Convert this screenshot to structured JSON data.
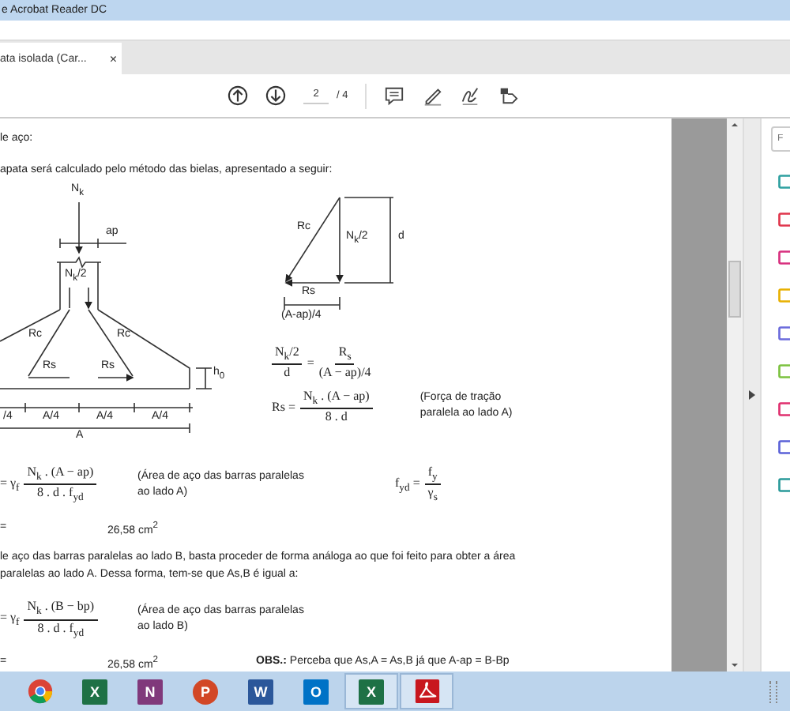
{
  "window": {
    "title": "e Acrobat Reader DC"
  },
  "tabs": [
    {
      "label": "ata isolada (Car...",
      "selected": true,
      "close": "×"
    }
  ],
  "toolbar": {
    "page_value": "2",
    "page_total": "/ 4"
  },
  "document": {
    "heading": "le aço:",
    "intro": "apata será calculado pelo método das bielas, apresentado a seguir:",
    "footing_diagram": {
      "load": "N$_{k}$",
      "column_width": "ap",
      "half_load": "N$_{k}$/2",
      "struts": [
        "Rc",
        "Rc"
      ],
      "ties": [
        "Rs",
        "Rs"
      ],
      "height": "h$_{0}$",
      "segments": [
        "/4",
        "A/4",
        "A/4",
        "A/4"
      ],
      "width": "A"
    },
    "force_triangle": {
      "strut": "Rc",
      "load": "N$_{k}$/2",
      "depth": "d",
      "tie": "Rs",
      "base": "(A-ap)/4"
    },
    "equations": [
      {
        "parts": [
          {
            "kind": "frac",
            "num": "N$_{k}$/2",
            "den": "d"
          },
          {
            "kind": "text",
            "text": "="
          },
          {
            "kind": "frac",
            "num": "R$_{s}$",
            "den": "(A − ap)/4"
          }
        ]
      },
      {
        "parts": [
          {
            "kind": "text",
            "text": "Rs ="
          },
          {
            "kind": "frac",
            "num": "N$_{k}$ . (A − ap)",
            "den": "8 . d"
          }
        ],
        "note": [
          "(Força de tração",
          "paralela ao lado A)"
        ]
      }
    ],
    "rows": [
      {
        "kind": "formula_row",
        "formula": [
          {
            "kind": "text",
            "text": "= γ$_{f}$"
          },
          {
            "kind": "frac",
            "num": "N$_{k}$ . (A − ap)",
            "den": "8 . d . f$_{yd}$"
          }
        ],
        "note": [
          "(Área de aço das barras paralelas",
          "ao lado A)"
        ],
        "side_formula": [
          {
            "kind": "text",
            "text": "f$_{yd}$ ="
          },
          {
            "kind": "frac",
            "num": "f$_{y}$",
            "den": "γ$_{s}$"
          }
        ]
      },
      {
        "kind": "result",
        "sign": "=",
        "value": "26,58 cm$^{2}$"
      },
      {
        "kind": "paragraph",
        "lines": [
          "le aço das barras paralelas ao lado B, basta proceder de forma análoga ao que foi feito para obter a área",
          "paralelas ao lado A. Dessa forma, tem-se que As,B é igual a:"
        ]
      },
      {
        "kind": "formula_row",
        "formula": [
          {
            "kind": "text",
            "text": "= γ$_{f}$"
          },
          {
            "kind": "frac",
            "num": "N$_{k}$ . (B − bp)",
            "den": "8 . d . f$_{yd}$"
          }
        ],
        "note": [
          "(Área de aço das barras paralelas",
          "ao lado B)"
        ]
      },
      {
        "kind": "result",
        "sign": "=",
        "value": "26,58 cm$^{2}$",
        "remark": "**OBS.:** Perceba que As,A = As,B já que A-ap = B-Bp"
      }
    ]
  },
  "right_panel": {
    "search": {
      "placeholder": "F"
    },
    "tools": [
      {
        "color": "#2ea0a0"
      },
      {
        "color": "#e0364c"
      },
      {
        "color": "#d8307f"
      },
      {
        "color": "#e8b000"
      },
      {
        "color": "#6b6bdc"
      },
      {
        "color": "#7cc240"
      },
      {
        "color": "#e0306f"
      },
      {
        "color": "#5b62d8"
      },
      {
        "color": "#2a9a9a"
      }
    ]
  },
  "taskbar": {
    "apps": [
      {
        "kind": "chrome",
        "selected": false
      },
      {
        "kind": "tile",
        "letter": "X",
        "color": "#1e7145",
        "selected": false
      },
      {
        "kind": "tile",
        "letter": "N",
        "color": "#80397b",
        "selected": false
      },
      {
        "kind": "round",
        "letter": "P",
        "color": "#d24726",
        "selected": false
      },
      {
        "kind": "tile",
        "letter": "W",
        "color": "#2b579a",
        "selected": false
      },
      {
        "kind": "tile",
        "letter": "O",
        "color": "#0072c6",
        "selected": false
      },
      {
        "kind": "tile",
        "letter": "X",
        "color": "#1e7145",
        "selected": true
      },
      {
        "kind": "acrobat",
        "selected": true
      }
    ]
  }
}
